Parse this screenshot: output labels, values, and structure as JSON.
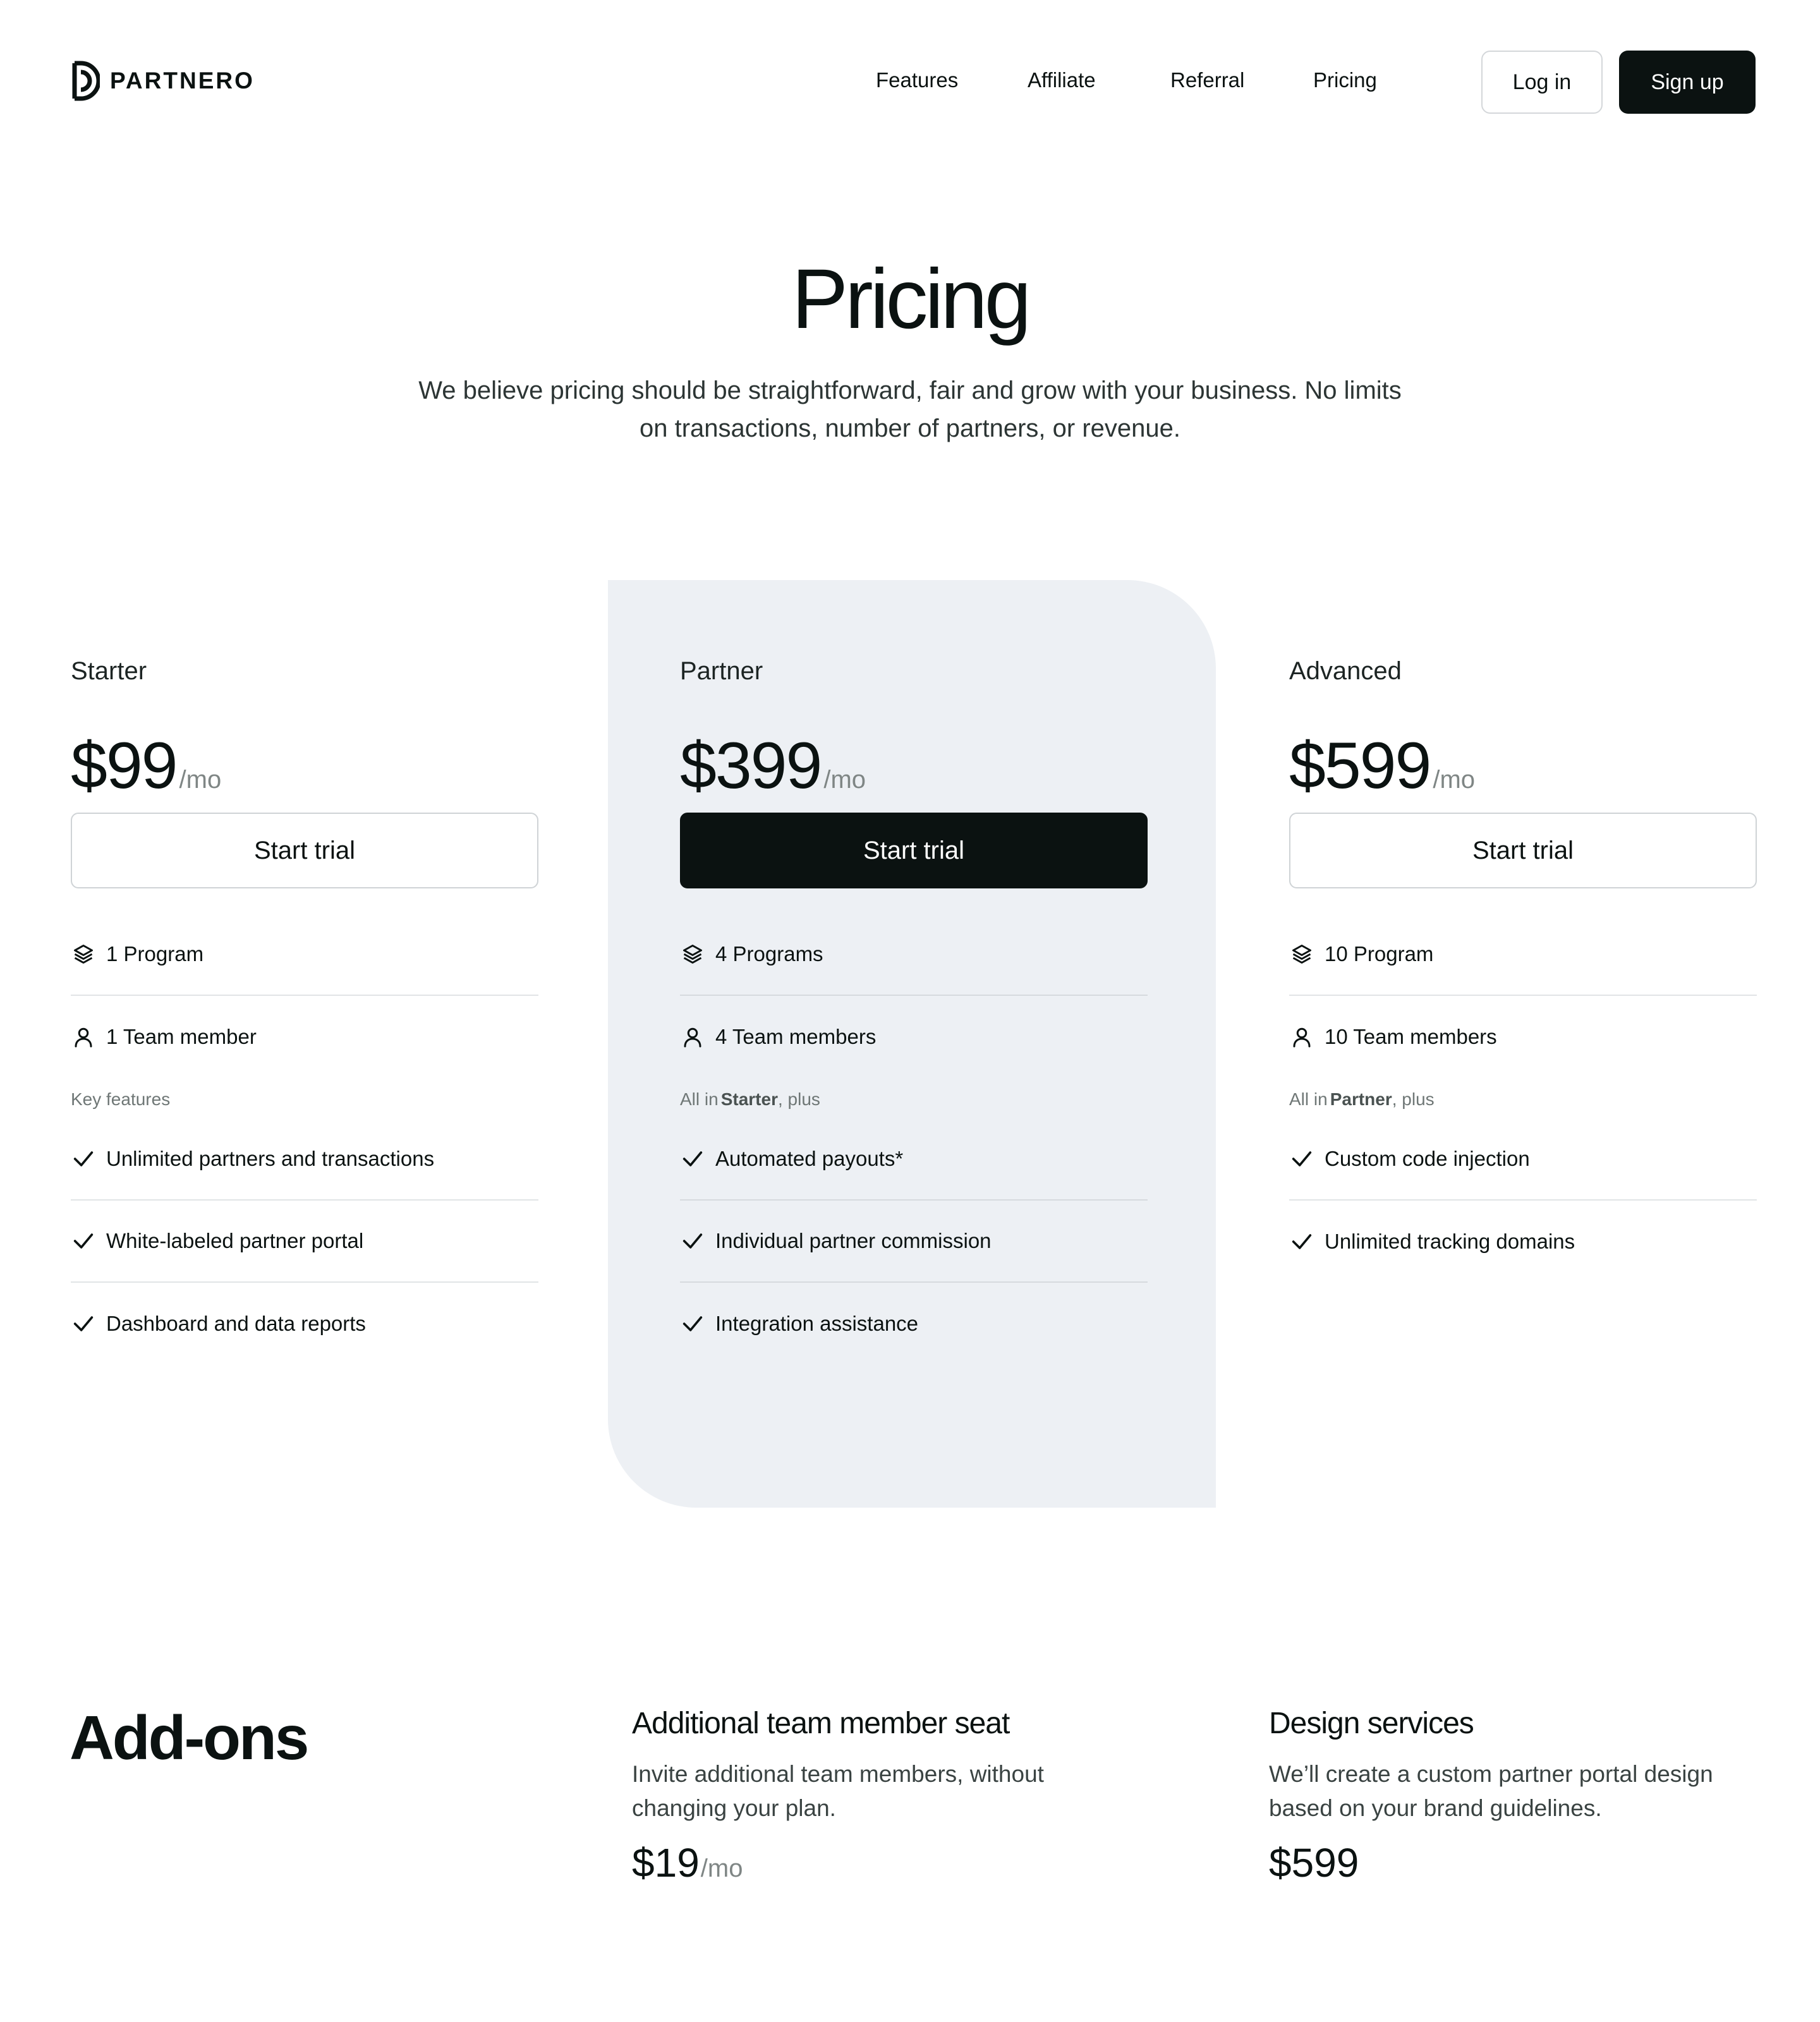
{
  "brand": {
    "name": "PARTNERO"
  },
  "nav": {
    "items": [
      "Features",
      "Affiliate",
      "Referral",
      "Pricing"
    ],
    "login": "Log in",
    "signup": "Sign up"
  },
  "hero": {
    "title": "Pricing",
    "subtitle": "We believe pricing should be straightforward, fair and grow with your business. No limits on transactions, number of partners, or revenue."
  },
  "plans": [
    {
      "name": "Starter",
      "price": "$99",
      "per": "/mo",
      "cta": "Start trial",
      "programs": "1 Program",
      "team": "1 Team member",
      "section_label": "Key features",
      "features": [
        "Unlimited partners and transactions",
        "White-labeled partner portal",
        "Dashboard and data reports"
      ]
    },
    {
      "name": "Partner",
      "price": "$399",
      "per": "/mo",
      "cta": "Start trial",
      "programs": "4 Programs",
      "team": "4 Team members",
      "section_prefix": "All in",
      "section_bold": "Starter",
      "section_suffix": ", plus",
      "features": [
        "Automated payouts*",
        "Individual partner commission",
        "Integration assistance"
      ]
    },
    {
      "name": "Advanced",
      "price": "$599",
      "per": "/mo",
      "cta": "Start trial",
      "programs": "10 Program",
      "team": "10 Team members",
      "section_prefix": "All in",
      "section_bold": "Partner",
      "section_suffix": ", plus",
      "features": [
        "Custom code injection",
        "Unlimited tracking domains"
      ]
    }
  ],
  "addons": {
    "title": "Add-ons",
    "items": [
      {
        "title": "Additional team member seat",
        "desc": "Invite additional team members, without changing your plan.",
        "price": "$19",
        "per": "/mo"
      },
      {
        "title": "Design services",
        "desc": "We’ll create a custom partner portal design based on your brand guidelines.",
        "price": "$599"
      }
    ]
  },
  "icons": {
    "logo": "partnero-logo-icon",
    "program": "layers-icon",
    "team": "user-icon",
    "feature": "check-icon"
  },
  "colors": {
    "primary": "#0b1211",
    "highlight_bg": "#edf0f4",
    "muted": "#7f8685"
  }
}
